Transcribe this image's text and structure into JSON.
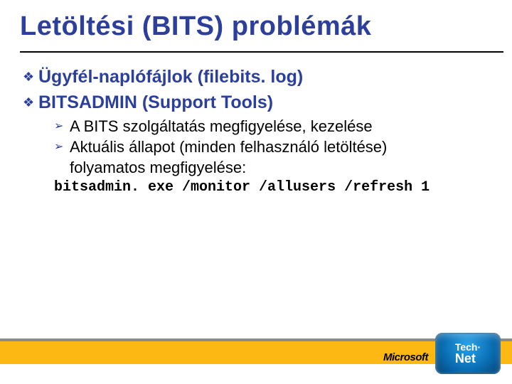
{
  "title": "Letöltési (BITS) problémák",
  "bullets": {
    "b1": {
      "marker": "❖",
      "text": "Ügyfél-naplófájlok (filebits. log)"
    },
    "b2": {
      "marker": "❖",
      "text": "BITSADMIN (Support Tools)"
    }
  },
  "sub": {
    "s1": {
      "marker": "➢",
      "text": "A BITS szolgáltatás megfigyelése, kezelése"
    },
    "s2": {
      "marker": "➢",
      "text": "Aktuális állapot (minden felhasználó letöltése)",
      "cont": "folyamatos megfigyelése:"
    }
  },
  "code": "bitsadmin. exe /monitor /allusers /refresh 1",
  "footer": {
    "ms": "Microsoft",
    "technet_top": "Tech·",
    "technet_bottom": "Net"
  }
}
